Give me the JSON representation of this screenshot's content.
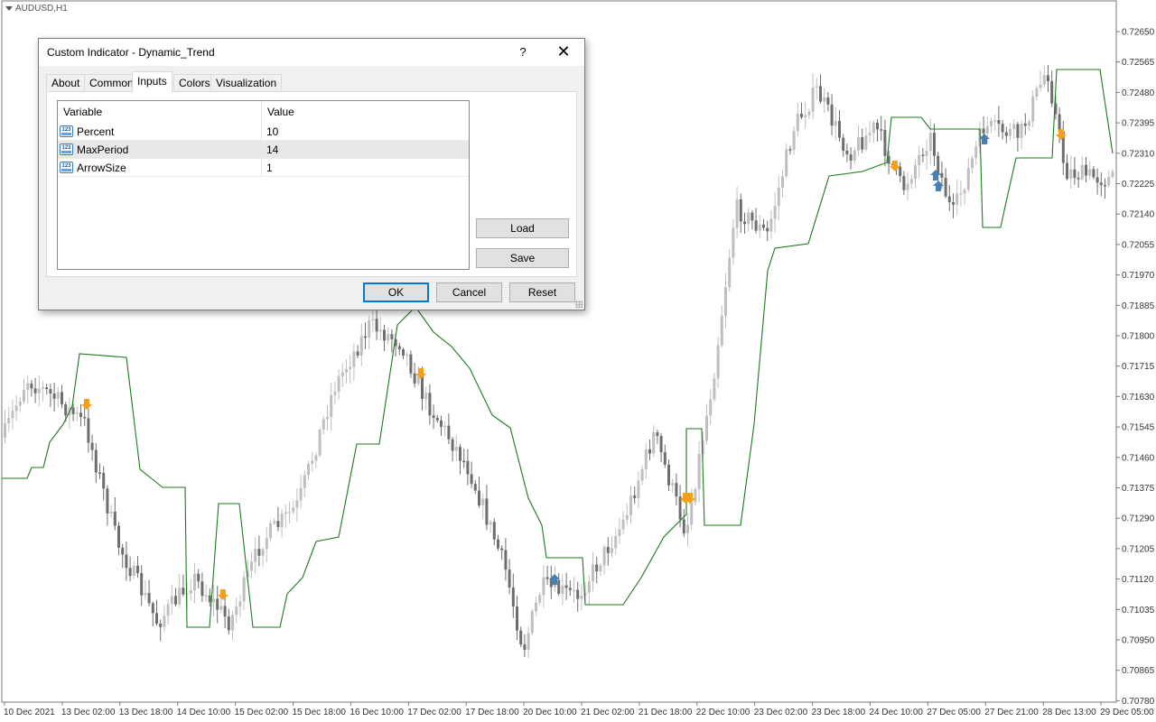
{
  "chart": {
    "title": "AUDUSD,H1",
    "price_labels": [
      "0.72650",
      "0.72565",
      "0.72480",
      "0.72395",
      "0.72310",
      "0.72225",
      "0.72140",
      "0.72055",
      "0.71970",
      "0.71885",
      "0.71800",
      "0.71715",
      "0.71630",
      "0.71545",
      "0.71460",
      "0.71375",
      "0.71290",
      "0.71205",
      "0.71120",
      "0.71035",
      "0.70950",
      "0.70865",
      "0.70780"
    ],
    "time_labels": [
      "10 Dec 2021",
      "13 Dec 02:00",
      "13 Dec 18:00",
      "14 Dec 10:00",
      "15 Dec 02:00",
      "15 Dec 18:00",
      "16 Dec 10:00",
      "17 Dec 02:00",
      "17 Dec 18:00",
      "20 Dec 10:00",
      "21 Dec 02:00",
      "21 Dec 18:00",
      "22 Dec 10:00",
      "23 Dec 02:00",
      "23 Dec 18:00",
      "24 Dec 10:00",
      "27 Dec 05:00",
      "27 Dec 21:00",
      "28 Dec 13:00",
      "29 Dec 05:00"
    ],
    "colors": {
      "bull_candle": "#bfbfbf",
      "bear_candle": "#6e6e6e",
      "trend_line": "#1a7a1a",
      "arrow_down": "#f5a01a",
      "arrow_up": "#4a7fb5",
      "axis": "#7a7a7a"
    }
  },
  "dialog": {
    "title": "Custom Indicator - Dynamic_Trend",
    "help_glyph": "?",
    "close_glyph": "✕",
    "tabs": [
      "About",
      "Common",
      "Inputs",
      "Colors",
      "Visualization"
    ],
    "active_tab": "Inputs",
    "grid": {
      "columns": [
        "Variable",
        "Value"
      ],
      "icon_text": "123",
      "rows": [
        {
          "variable": "Percent",
          "value": "10"
        },
        {
          "variable": "MaxPeriod",
          "value": "14"
        },
        {
          "variable": "ArrowSize",
          "value": "1"
        }
      ],
      "selected_row": 1
    },
    "buttons": {
      "load": "Load",
      "save": "Save",
      "ok": "OK",
      "cancel": "Cancel",
      "reset": "Reset"
    }
  }
}
